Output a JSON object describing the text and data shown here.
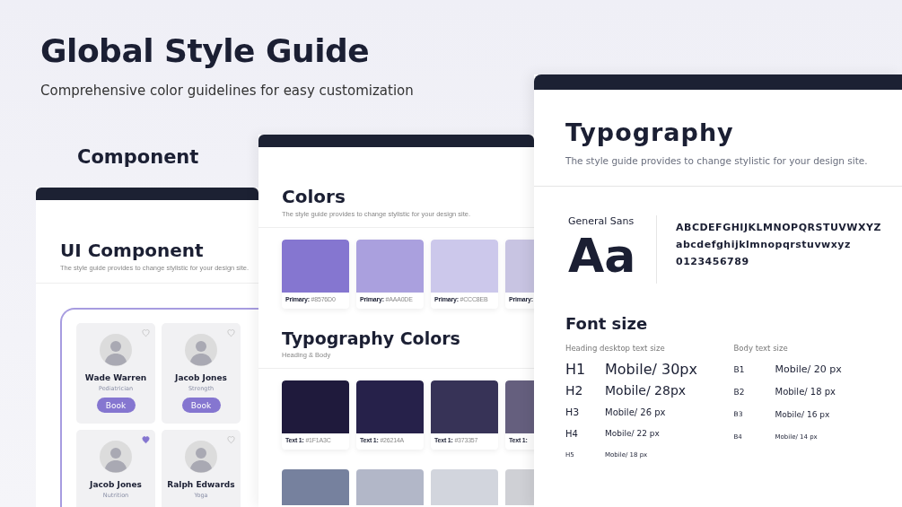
{
  "header": {
    "title": "Global Style Guide",
    "subtitle": "Comprehensive color guidelines for easy customization",
    "section_label": "Component"
  },
  "component_panel": {
    "title": "UI Component",
    "description": "The style guide provides to change stylistic for your design site.",
    "cards": [
      {
        "name": "Wade Warren",
        "role": "Pediatrician",
        "button": "Book",
        "liked": false
      },
      {
        "name": "Jacob Jones",
        "role": "Strength",
        "button": "Book",
        "liked": false
      },
      {
        "name": "Jacob Jones",
        "role": "Nutrition",
        "liked": true
      },
      {
        "name": "Ralph Edwards",
        "role": "Yoga",
        "liked": false
      }
    ]
  },
  "colors_panel": {
    "title": "Colors",
    "description": "The style guide provides to change stylistic for your design site.",
    "primary_swatches": [
      {
        "label": "Primary:",
        "hex": "#8576D0",
        "color": "#8576d0"
      },
      {
        "label": "Primary:",
        "hex": "#AAA0DE",
        "color": "#aaa0de"
      },
      {
        "label": "Primary:",
        "hex": "#CCC8EB",
        "color": "#ccc8eb"
      },
      {
        "label": "Primary:",
        "color": "#c8c4e2"
      }
    ],
    "typography_title": "Typography Colors",
    "typography_subtitle": "Heading & Body",
    "text_swatches": [
      {
        "label": "Text 1:",
        "hex": "#1F1A3C",
        "color": "#1f1a3c"
      },
      {
        "label": "Text 1:",
        "hex": "#26214A",
        "color": "#26214a"
      },
      {
        "label": "Text 1:",
        "hex": "#373357",
        "color": "#373357"
      },
      {
        "label": "Text 1:",
        "color": "#655f7e"
      }
    ],
    "more_swatches": [
      {
        "color": "#76819e"
      },
      {
        "color": "#b2b7c8"
      },
      {
        "color": "#d2d5dd"
      },
      {
        "color": "#cfd0d5"
      }
    ]
  },
  "typography_panel": {
    "title": "Typography",
    "description": "The style guide provides to change stylistic for your design site.",
    "font_name": "General Sans",
    "sample": "Aa",
    "uppercase": "ABCDEFGHIJKLMNOPQRSTUVWXYZ",
    "lowercase": "abcdefghijklmnopqrstuvwxyz",
    "digits": "0123456789",
    "font_size_title": "Font size",
    "heading_label": "Heading desktop text size",
    "body_label": "Body text size",
    "headings": [
      {
        "tag": "H1",
        "size": "Mobile/ 30px"
      },
      {
        "tag": "H2",
        "size": "Mobile/ 28px"
      },
      {
        "tag": "H3",
        "size": "Mobile/ 26 px"
      },
      {
        "tag": "H4",
        "size": "Mobile/ 22 px"
      },
      {
        "tag": "H5",
        "size": "Mobile/ 18 px"
      }
    ],
    "body": [
      {
        "tag": "B1",
        "size": "Mobile/ 20 px"
      },
      {
        "tag": "B2",
        "size": "Mobile/ 18 px"
      },
      {
        "tag": "B3",
        "size": "Mobile/ 16 px"
      },
      {
        "tag": "B4",
        "size": "Mobile/ 14 px"
      }
    ]
  }
}
